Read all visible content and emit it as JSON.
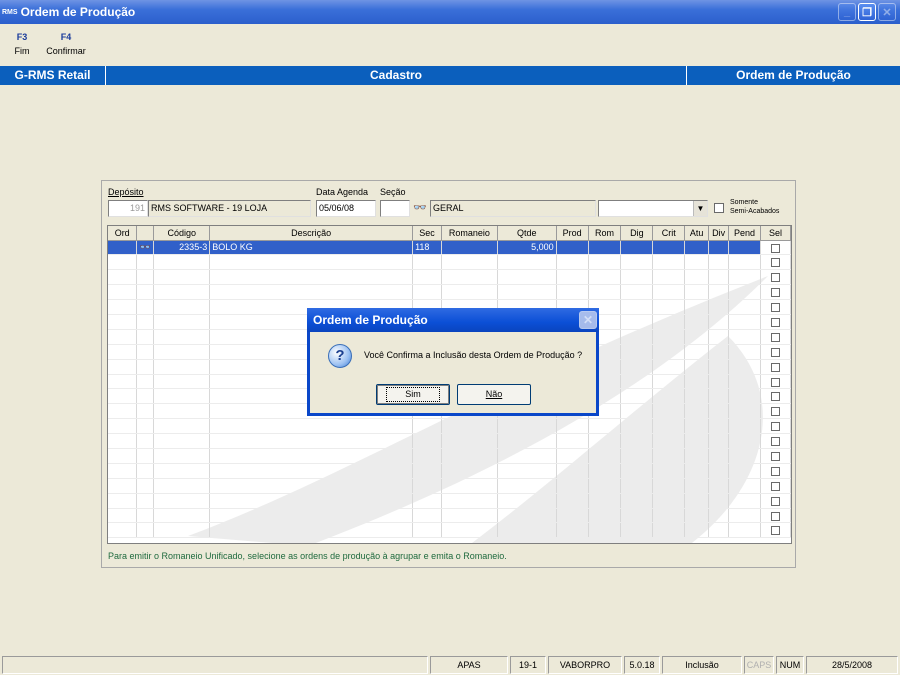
{
  "window": {
    "title": "Ordem de Produção",
    "logo": "RMS",
    "buttons": [
      "minimize-icon",
      "restore-icon",
      "close-icon"
    ]
  },
  "toolbar": {
    "items": [
      {
        "key": "F3",
        "label": "Fim"
      },
      {
        "key": "F4",
        "label": "Confirmar"
      }
    ]
  },
  "header": {
    "left": "G-RMS Retail",
    "center": "Cadastro",
    "right": "Ordem de Produção"
  },
  "form": {
    "deposito_label": "Depósito",
    "deposito_code": "191",
    "deposito_name": "RMS SOFTWARE - 19 LOJA",
    "data_agenda_label": "Data Agenda",
    "data_agenda_value": "05/06/08",
    "secao_label": "Seção",
    "secao_code": "",
    "secao_name": "GERAL",
    "combo_value": "",
    "somente_label_1": "Somente",
    "somente_label_2": "Semi-Acabados"
  },
  "grid": {
    "columns": [
      "Ord",
      "",
      "Código",
      "Descrição",
      "Sec",
      "Romaneio",
      "Qtde",
      "Prod",
      "Rom",
      "Dig",
      "Crit",
      "Atu",
      "Div",
      "Pend",
      "Sel"
    ],
    "rows": [
      {
        "ord": "",
        "codigo": "2335-3",
        "descricao": "BOLO KG",
        "sec": "118",
        "romaneio": "",
        "qtde": "5,000"
      }
    ]
  },
  "hint": "Para emitir o Romaneio Unificado, selecione as ordens de produção à agrupar e emita o Romaneio.",
  "dialog": {
    "title": "Ordem de Produção",
    "message": "Você Confirma a Inclusão desta Ordem de Produção ?",
    "yes": "Sim",
    "no": "Não"
  },
  "statusbar": {
    "items": [
      "APAS",
      "19-1",
      "VABORPRO",
      "5.0.18",
      "Inclusão",
      "CAPS",
      "NUM",
      "28/5/2008"
    ]
  },
  "colors": {
    "header_bar": "#0b5fbd",
    "selected_row": "#3160c9",
    "hint_text": "#1f6a3e"
  }
}
